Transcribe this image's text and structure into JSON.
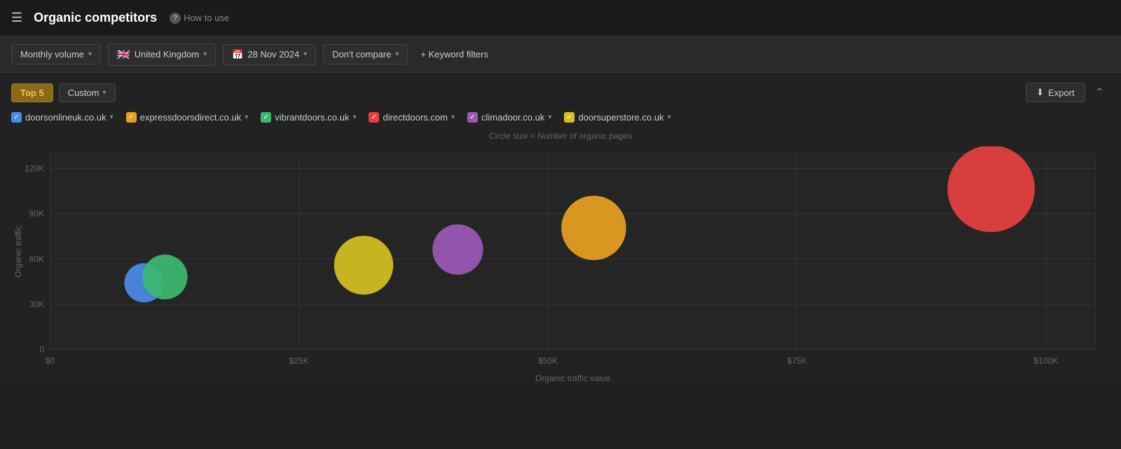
{
  "topbar": {
    "menu_icon": "☰",
    "title": "Organic competitors",
    "help_icon": "?",
    "help_label": "How to use"
  },
  "filters": {
    "volume_label": "Monthly volume",
    "country_flag": "🇬🇧",
    "country_label": "United Kingdom",
    "date_label": "28 Nov 2024",
    "compare_label": "Don't compare",
    "keyword_filters_label": "+ Keyword filters"
  },
  "toolbar": {
    "top5_label": "Top 5",
    "custom_label": "Custom",
    "export_label": "Export",
    "chart_hint": "Circle size = Number of organic pages"
  },
  "competitors": [
    {
      "domain": "doorsonlineuk.co.uk",
      "color": "#4a8be8",
      "checked": true
    },
    {
      "domain": "expressdoorsdirect.co.uk",
      "color": "#e8a020",
      "checked": true
    },
    {
      "domain": "vibrantdoors.co.uk",
      "color": "#3cb870",
      "checked": true
    },
    {
      "domain": "directdoors.com",
      "color": "#e84040",
      "checked": true
    },
    {
      "domain": "climadoor.co.uk",
      "color": "#9b59b6",
      "checked": true
    },
    {
      "domain": "doorsuperstore.co.uk",
      "color": "#d4c020",
      "checked": true
    }
  ],
  "chart": {
    "y_axis_label": "Organic traffic",
    "x_axis_label": "Organic traffic value",
    "y_ticks": [
      "0",
      "30K",
      "60K",
      "90K",
      "120K"
    ],
    "x_ticks": [
      "$0",
      "$25K",
      "$50K",
      "$75K",
      "$100K"
    ],
    "bubbles": [
      {
        "id": "doorsonlineuk",
        "cx_pct": 9,
        "cy_pct": 66,
        "r": 28,
        "color": "#4a8be8"
      },
      {
        "id": "expressdoorsdirect",
        "cx_pct": 11,
        "cy_pct": 63,
        "r": 32,
        "color": "#3cb870"
      },
      {
        "id": "vibrantdoors",
        "cx_pct": 30,
        "cy_pct": 57,
        "r": 42,
        "color": "#d4c020"
      },
      {
        "id": "directdoors",
        "cx_pct": 39,
        "cy_pct": 49,
        "r": 36,
        "color": "#9b59b6"
      },
      {
        "id": "climadoor",
        "cx_pct": 52,
        "cy_pct": 38,
        "r": 46,
        "color": "#e8a020"
      },
      {
        "id": "doorsuperstore",
        "cx_pct": 90,
        "cy_pct": 18,
        "r": 62,
        "color": "#e84040"
      }
    ]
  }
}
